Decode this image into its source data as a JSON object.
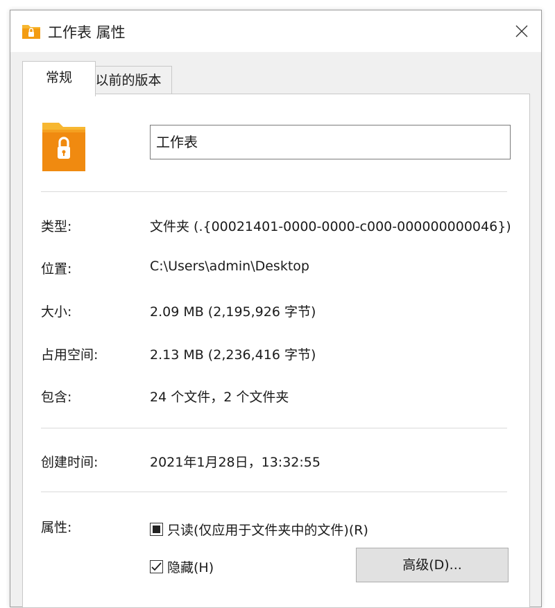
{
  "window": {
    "title": "工作表 属性",
    "title_icon": "locked-folder-icon",
    "close_icon": "close-icon"
  },
  "tabs": [
    {
      "label": "常规",
      "active": true
    },
    {
      "label": "以前的版本",
      "active": false
    }
  ],
  "general": {
    "folder_icon": "locked-folder-icon",
    "name_value": "工作表",
    "rows": [
      {
        "label": "类型:",
        "value": "文件夹 (.{00021401-0000-0000-c000-000000000046})"
      },
      {
        "label": "位置:",
        "value": "C:\\Users\\admin\\Desktop"
      },
      {
        "label": "大小:",
        "value": "2.09 MB (2,195,926 字节)"
      },
      {
        "label": "占用空间:",
        "value": "2.13 MB (2,236,416 字节)"
      },
      {
        "label": "包含:",
        "value": "24 个文件，2 个文件夹"
      }
    ],
    "created": {
      "label": "创建时间:",
      "value": "2021年1月28日，13:32:55"
    },
    "attributes": {
      "label": "属性:",
      "readonly": {
        "label": "只读(仅应用于文件夹中的文件)(R)",
        "state": "indeterminate"
      },
      "hidden": {
        "label": "隐藏(H)",
        "state": "checked"
      },
      "advanced_button": "高级(D)..."
    }
  },
  "colors": {
    "folder_orange": "#f5a623",
    "folder_dark": "#e07b10",
    "accent": "#0a64d8"
  }
}
